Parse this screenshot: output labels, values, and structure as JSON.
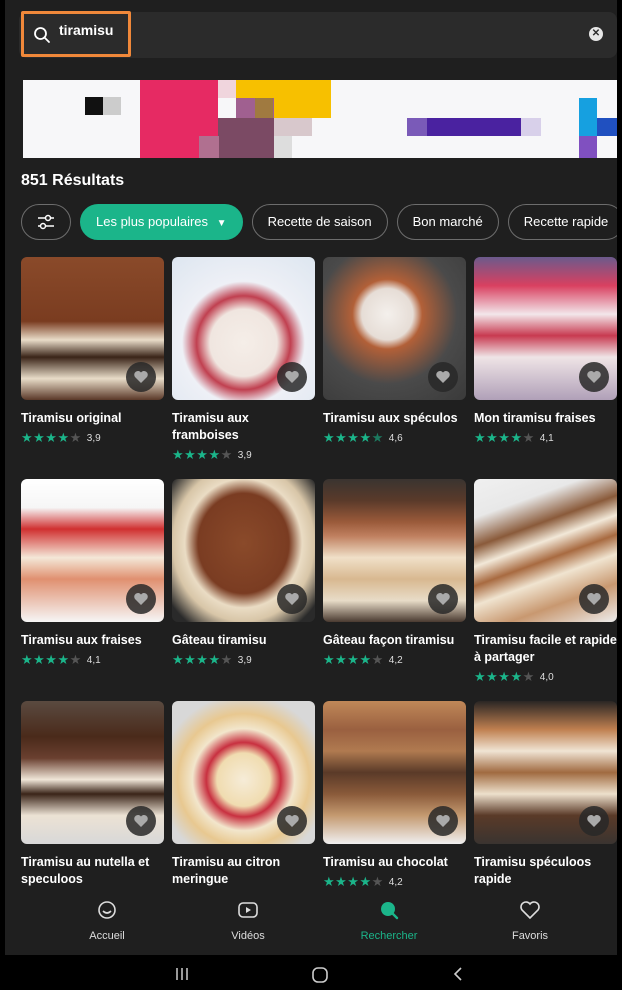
{
  "search": {
    "value": "tiramisu",
    "placeholder": ""
  },
  "results_label": "851 Résultats",
  "chips": [
    "Les plus populaires",
    "Recette de saison",
    "Bon marché",
    "Recette rapide"
  ],
  "active_chip_icon": "chevron-down-icon",
  "cards": [
    {
      "title": "Tiramisu original",
      "stars": 4,
      "rating": "3,9"
    },
    {
      "title": "Tiramisu aux framboises",
      "stars": 4,
      "rating": "3,9"
    },
    {
      "title": "Tiramisu aux spéculos",
      "stars": 4.5,
      "rating": "4,6"
    },
    {
      "title": "Mon tiramisu fraises",
      "stars": 4,
      "rating": "4,1"
    },
    {
      "title": "Tiramisu aux fraises",
      "stars": 4,
      "rating": "4,1"
    },
    {
      "title": "Gâteau tiramisu",
      "stars": 4,
      "rating": "3,9"
    },
    {
      "title": "Gâteau façon tiramisu",
      "stars": 4,
      "rating": "4,2"
    },
    {
      "title": "Tiramisu facile et rapide à partager",
      "stars": 4,
      "rating": "4,0"
    },
    {
      "title": "Tiramisu au nutella et speculoos",
      "stars": null,
      "rating": null
    },
    {
      "title": "Tiramisu au citron meringue",
      "stars": null,
      "rating": null
    },
    {
      "title": "Tiramisu au chocolat",
      "stars": 4,
      "rating": "4,2"
    },
    {
      "title": "Tiramisu spéculoos rapide",
      "stars": null,
      "rating": null
    }
  ],
  "nav": {
    "home": "Accueil",
    "videos": "Vidéos",
    "search": "Rechercher",
    "favorites": "Favoris"
  },
  "colors": {
    "accent": "#1bb58a",
    "highlight": "#f0883a",
    "background": "#1f1f1f"
  }
}
